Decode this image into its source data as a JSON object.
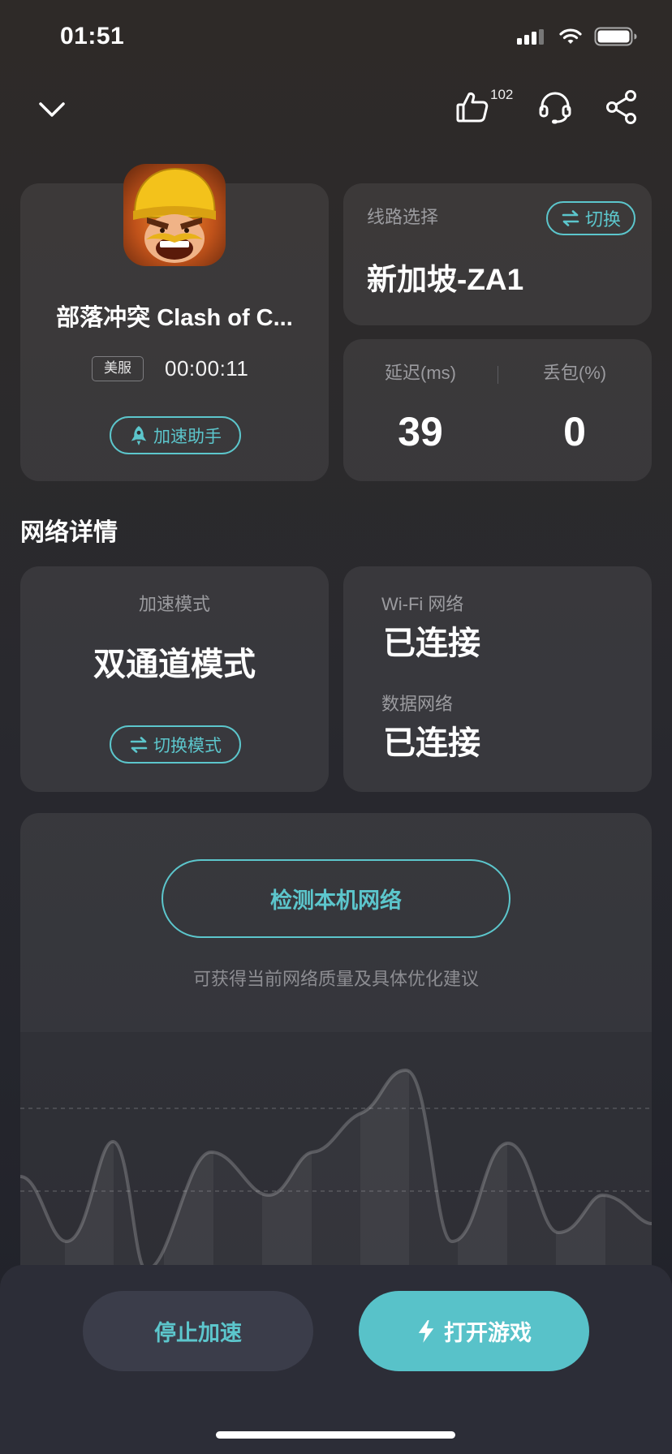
{
  "status_bar": {
    "time": "01:51"
  },
  "header": {
    "like_count": "102"
  },
  "game": {
    "name": "部落冲突 Clash of C...",
    "region_badge": "美服",
    "timer": "00:00:11",
    "assistant_label": "加速助手"
  },
  "route": {
    "title": "线路选择",
    "switch_label": "切换",
    "server": "新加坡-ZA1"
  },
  "stats": {
    "latency_label": "延迟(ms)",
    "latency_value": "39",
    "loss_label": "丢包(%)",
    "loss_value": "0"
  },
  "network_section": {
    "heading": "网络详情"
  },
  "mode": {
    "label": "加速模式",
    "value": "双通道模式",
    "switch_label": "切换模式"
  },
  "connectivity": {
    "wifi_label": "Wi-Fi 网络",
    "wifi_status": "已连接",
    "data_label": "数据网络",
    "data_status": "已连接"
  },
  "diagnose": {
    "button_label": "检测本机网络",
    "description": "可获得当前网络质量及具体优化建议"
  },
  "bottom_bar": {
    "stop_label": "停止加速",
    "open_label": "打开游戏"
  },
  "icons": {
    "back": "chevron-down-icon",
    "like": "thumbs-up-icon",
    "support": "headset-icon",
    "share": "share-icon",
    "assistant": "rocket-icon",
    "switch": "swap-arrows-icon",
    "open": "lightning-icon",
    "status": [
      "cellular-signal-icon",
      "wifi-icon",
      "battery-icon"
    ]
  },
  "colors": {
    "accent": "#5cc6cc",
    "open_button": "#58c2c9",
    "stop_button": "#3b3d4a",
    "background_top": "#2e2a28",
    "background_bottom": "#202129"
  }
}
